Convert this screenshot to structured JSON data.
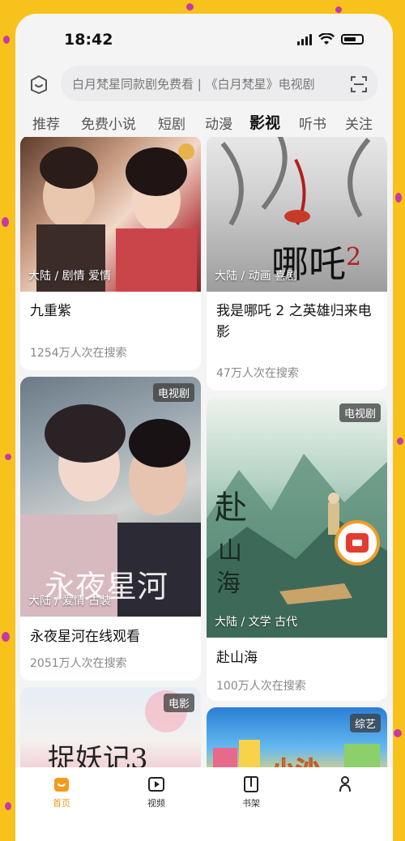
{
  "status": {
    "time": "18:42"
  },
  "search": {
    "placeholder": "白月梵星同款剧免费看 | 《白月梵星》电视剧"
  },
  "tabs": [
    {
      "label": "推荐"
    },
    {
      "label": "免费小说"
    },
    {
      "label": "短剧"
    },
    {
      "label": "动漫"
    },
    {
      "label": "影视",
      "active": true
    },
    {
      "label": "听书"
    },
    {
      "label": "关注"
    }
  ],
  "cards": [
    {
      "tags": "大陆 / 剧情 爱情",
      "badge": "",
      "title": "九重紫",
      "subtitle": "1254万人次在搜索"
    },
    {
      "tags": "大陆 / 动画 喜剧",
      "badge": "",
      "title": "我是哪吒 2 之英雄归来电影",
      "subtitle": "47万人次在搜索"
    },
    {
      "tags": "大陆 / 爱情 古装",
      "badge": "电视剧",
      "title": "永夜星河在线观看",
      "subtitle": "2051万人次在搜索"
    },
    {
      "tags": "大陆 / 文学 古代",
      "badge": "电视剧",
      "title": "赴山海",
      "subtitle": "100万人次在搜索"
    },
    {
      "tags": "",
      "badge": "电影",
      "title": "",
      "subtitle": ""
    },
    {
      "tags": "",
      "badge": "综艺",
      "title": "",
      "subtitle": ""
    }
  ],
  "bottom_nav": [
    {
      "label": "首页",
      "icon": "home-icon",
      "active": true
    },
    {
      "label": "视频",
      "icon": "video-icon"
    },
    {
      "label": "书架",
      "icon": "bookshelf-icon"
    },
    {
      "label": "",
      "icon": "profile-icon"
    }
  ],
  "colors": {
    "accent": "#f29b1d",
    "page_bg": "#f7c21c"
  }
}
